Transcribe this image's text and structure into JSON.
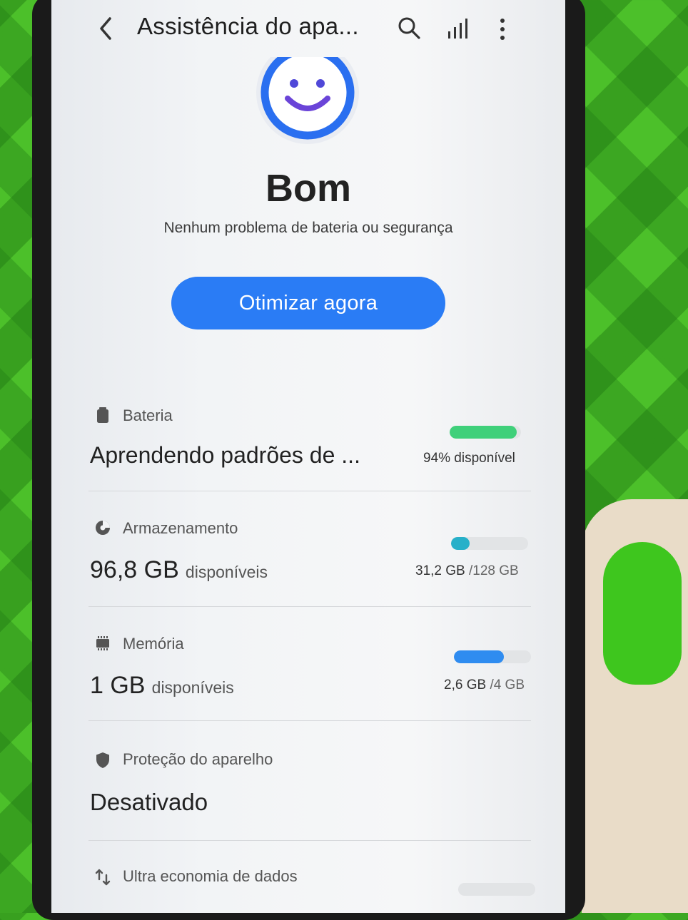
{
  "header": {
    "title": "Assistência do apa..."
  },
  "status": {
    "title": "Bom",
    "subtitle": "Nenhum problema de bateria ou segurança",
    "button_label": "Otimizar agora",
    "accent_color": "#2a7cf5"
  },
  "rows": {
    "battery": {
      "label": "Bateria",
      "value": "Aprendendo padrões de ...",
      "meta": "94% disponível",
      "level_percent": 94,
      "meter_color": "#3fd07a"
    },
    "storage": {
      "label": "Armazenamento",
      "value": "96,8 GB",
      "unit": "disponíveis",
      "used": "31,2 GB",
      "total": "/128 GB",
      "used_fraction": 0.24,
      "meter_color": "#27b0c9"
    },
    "memory": {
      "label": "Memória",
      "value": "1 GB",
      "unit": "disponíveis",
      "used": "2,6 GB",
      "total": "/4 GB",
      "used_fraction": 0.65,
      "meter_color": "#2f8cf0"
    },
    "protection": {
      "label": "Proteção do aparelho",
      "value": "Desativado"
    },
    "data_saver": {
      "label": "Ultra economia de dados"
    }
  }
}
